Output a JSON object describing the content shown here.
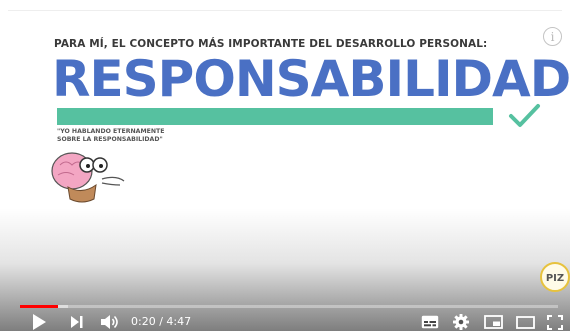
{
  "video": {
    "subtitle": "PARA MÍ, EL CONCEPTO MÁS IMPORTANTE DEL DESARROLLO PERSONAL:",
    "headline": "RESPONSABILIDAD",
    "quote": "\"YO HABLANDO ETERNAMENTE\nSOBRE LA RESPONSABILIDAD\"",
    "colors": {
      "headline": "#4a70c4",
      "bar": "#56c1a0",
      "check": "#56c1a0"
    },
    "badge_text": "PIZ"
  },
  "player": {
    "current_time": "0:20",
    "separator": "/",
    "duration": "4:47",
    "progress_fraction": 0.07,
    "buffered_fraction": 0.09,
    "icons": [
      "play-icon",
      "next-icon",
      "volume-icon",
      "subtitles-icon",
      "settings-icon",
      "miniplayer-icon",
      "theater-icon",
      "fullscreen-icon",
      "info-icon"
    ],
    "accent": "#ff0000"
  }
}
